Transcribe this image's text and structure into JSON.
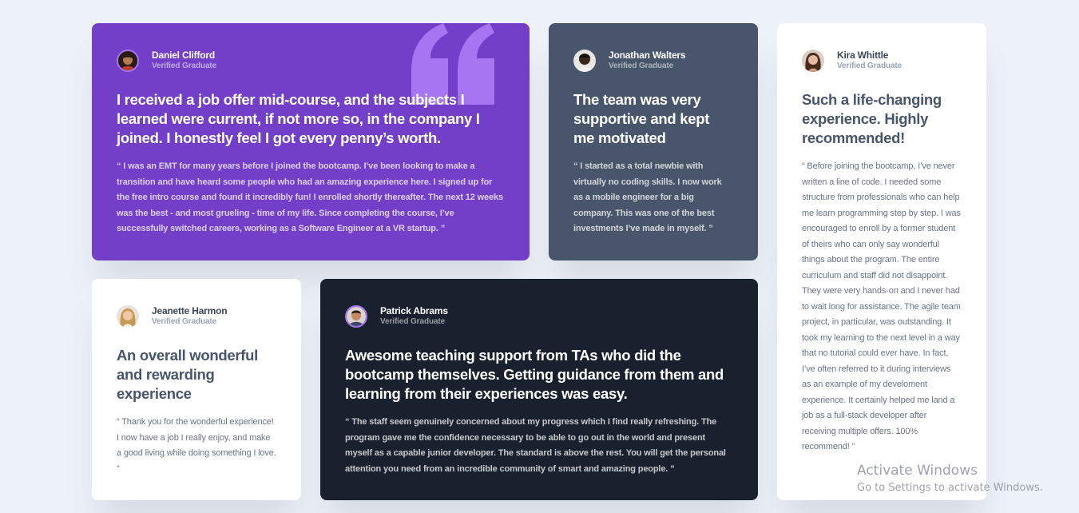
{
  "testimonials": {
    "daniel": {
      "name": "Daniel Clifford",
      "status": "Verified Graduate",
      "headline": "I received a job offer mid-course, and the subjects I learned were current, if not more so, in the company I joined. I honestly feel I got every penny’s worth.",
      "quote": "“ I was an EMT for many years before I joined the bootcamp. I’ve been looking to make a transition and have heard some people who had an amazing experience here. I signed up for the free intro course and found it incredibly fun! I enrolled shortly thereafter. The next 12 weeks was the best - and most grueling - time of my life. Since completing the course, I’ve successfully switched careers, working as a Software Engineer at a VR startup. ”"
    },
    "jonathan": {
      "name": "Jonathan Walters",
      "status": "Verified Graduate",
      "headline": "The team was very supportive and kept me motivated",
      "quote": "“ I started as a total newbie with virtually no coding skills. I now work as a mobile engineer for a big company. This was one of the best investments I’ve made in myself. ”"
    },
    "kira": {
      "name": "Kira Whittle",
      "status": "Verified Graduate",
      "headline": "Such a life-changing experience. Highly recommended!",
      "quote": "“ Before joining the bootcamp, I’ve never written a line of code. I needed some structure from professionals who can help me learn programming step by step. I was encouraged to enroll by a former student of theirs who can only say wonderful things about the program. The entire curriculum and staff did not disappoint. They were very hands-on and I never had to wait long for assistance. The agile team project, in particular, was outstanding. It took my learning to the next level in a way that no tutorial could ever have. In fact, I’ve often referred to it during interviews as an example of my develoment experience. It certainly helped me land a job as a full-stack developer after receiving multiple offers. 100% recommend! ”"
    },
    "jeanette": {
      "name": "Jeanette Harmon",
      "status": "Verified Graduate",
      "headline": "An overall wonderful and rewarding experience",
      "quote": "“ Thank you for the wonderful experience! I now have a job I really enjoy, and make a good living while doing something I love. ”"
    },
    "patrick": {
      "name": "Patrick Abrams",
      "status": "Verified Graduate",
      "headline": "Awesome teaching support from TAs who did the bootcamp themselves. Getting guidance from them and learning from their experiences was easy.",
      "quote": "“ The staff seem genuinely concerned about my progress which I find really refreshing. The program gave me the confidence necessary to be able to go out in the world and present myself as a capable junior developer. The standard is above the rest. You will get the personal attention you need from an incredible community of smart and amazing people. ”"
    }
  },
  "watermark": {
    "title": "Activate Windows",
    "subtitle": "Go to Settings to activate Windows."
  },
  "colors": {
    "background": "#edf1f8",
    "purple": "#733fc8",
    "slate": "#48556a",
    "dark": "#19212e",
    "white": "#ffffff",
    "accent": "#a775f1"
  },
  "icons": {
    "decorative_quote": "quotation-mark-icon"
  }
}
